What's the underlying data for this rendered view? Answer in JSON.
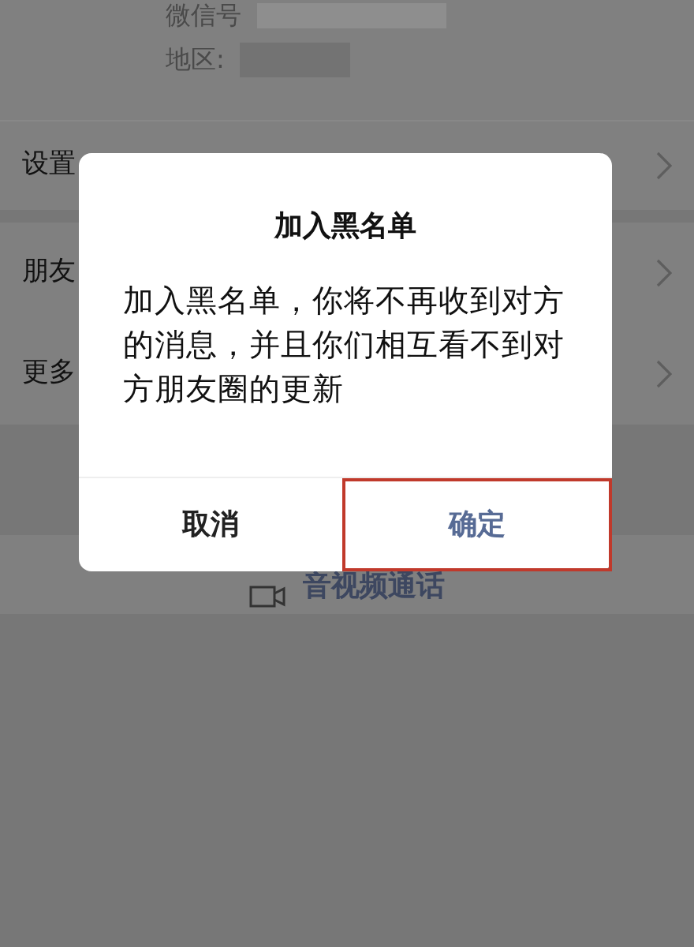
{
  "profile": {
    "fields": [
      {
        "label": "微信号"
      },
      {
        "label": "地区:"
      }
    ]
  },
  "menu": [
    {
      "label": "设置"
    },
    {
      "label": "朋友"
    },
    {
      "label": "更多"
    }
  ],
  "call_button": {
    "label": "音视频通话"
  },
  "dialog": {
    "title": "加入黑名单",
    "message": "加入黑名单，你将不再收到对方的消息，并且你们相互看不到对方朋友圈的更新",
    "buttons": [
      {
        "label": "取消",
        "kind": "cancel",
        "highlighted": false
      },
      {
        "label": "确定",
        "kind": "confirm",
        "highlighted": true
      }
    ]
  }
}
